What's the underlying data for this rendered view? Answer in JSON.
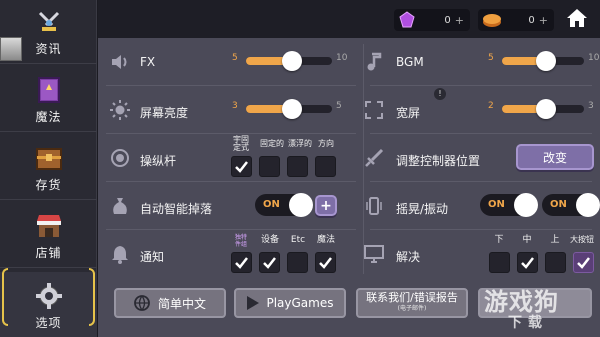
{
  "sidebar": {
    "items": [
      {
        "label": "资讯",
        "icon": "crossed-swords-icon"
      },
      {
        "label": "魔法",
        "icon": "spellbook-icon"
      },
      {
        "label": "存货",
        "icon": "treasure-chest-icon"
      },
      {
        "label": "店铺",
        "icon": "shop-icon"
      },
      {
        "label": "选项",
        "icon": "gear-icon"
      }
    ],
    "active": "选项"
  },
  "topbar": {
    "gems": "0",
    "coins": "0",
    "plus": "+"
  },
  "settings": {
    "fx": {
      "label": "FX",
      "min": "5",
      "max": "10",
      "value": 5,
      "range_max": 10
    },
    "bgm": {
      "label": "BGM",
      "min": "5",
      "max": "10",
      "value": 5,
      "range_max": 10
    },
    "brightness": {
      "label": "屏幕亮度",
      "min": "3",
      "max": "5",
      "value": 3,
      "range_max": 5
    },
    "widescreen": {
      "label": "宽屏",
      "min": "2",
      "max": "3",
      "value": 2,
      "range_max": 3
    },
    "joystick": {
      "label": "操纵杆",
      "columns": [
        "宇固\n定式",
        "固定的",
        "漂浮的",
        "方向"
      ],
      "checked": [
        true,
        false,
        false,
        false
      ]
    },
    "adjust_controller": {
      "label": "调整控制器位置",
      "button": "改变"
    },
    "auto_pickup": {
      "label": "自动智能掉落",
      "toggle": "ON",
      "add": "+"
    },
    "shake": {
      "label": "摇晃/振动",
      "toggle1": "ON",
      "toggle2": "ON"
    },
    "notify": {
      "label": "通知",
      "columns": [
        "独特\n件组",
        "设备",
        "Etc",
        "魔法"
      ],
      "checked": [
        true,
        true,
        false,
        true
      ]
    },
    "resolution": {
      "label": "解决",
      "columns": [
        "下",
        "中",
        "上",
        "大按钮"
      ],
      "checked": [
        false,
        true,
        false,
        true
      ]
    }
  },
  "hint": "!",
  "bottom": {
    "language": "简单中文",
    "playgames": "PlayGames",
    "contact": "联系我们/错误报告",
    "contact_sub": "(电子邮件)"
  },
  "watermark": {
    "main": "游戏狗",
    "sub": "下载"
  },
  "colors": {
    "accent": "#f0a64a",
    "button": "#7e6fa7",
    "bracket": "#e6c34a"
  }
}
